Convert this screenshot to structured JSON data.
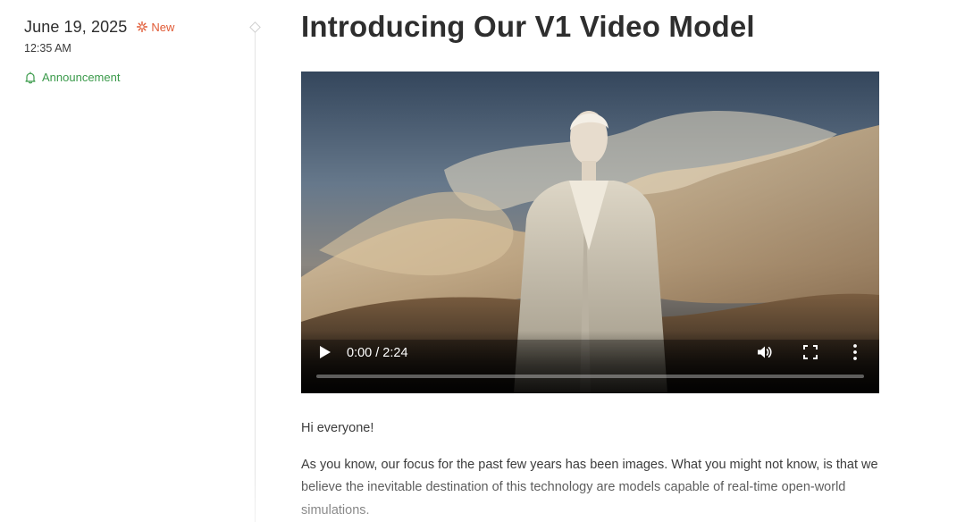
{
  "post": {
    "date": "June 19, 2025",
    "new_label": "New",
    "time": "12:35 AM",
    "category": "Announcement",
    "title": "Introducing Our V1 Video Model"
  },
  "video": {
    "time_display": "0:00 / 2:24",
    "progress": 0
  },
  "body": {
    "p1": "Hi everyone!",
    "p2": "As you know, our focus for the past few years has been images. What you might not know, is that we believe the inevitable destination of this technology are models capable of real-time open-world simulations."
  },
  "colors": {
    "accent_new": "#e05a35",
    "accent_category": "#3a9a4a"
  },
  "icons": {
    "new": "sparkle-icon",
    "category": "bell-icon",
    "play": "play-icon",
    "volume": "volume-icon",
    "fullscreen": "fullscreen-icon",
    "more": "more-vertical-icon"
  }
}
